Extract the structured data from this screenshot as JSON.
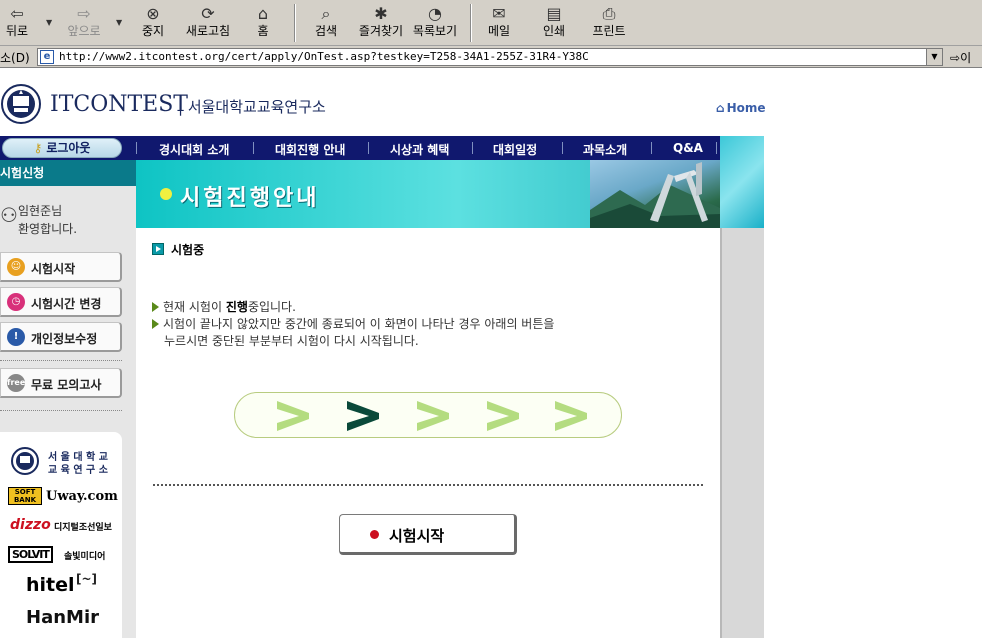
{
  "browser": {
    "toolbar": {
      "back": "뒤로",
      "forward": "앞으로",
      "stop": "중지",
      "refresh": "새로고침",
      "home": "홈",
      "search": "검색",
      "favorites": "즐겨찾기",
      "history": "목록보기",
      "mail": "메일",
      "print": "인쇄",
      "printer": "프린트"
    },
    "address": {
      "label": "소(D)",
      "url": "http://www2.itcontest.org/cert/apply/OnTest.asp?testkey=T258-34A1-255Z-31R4-Y38C",
      "go": "이"
    }
  },
  "header": {
    "logo_text": "ITCONTEST",
    "logo_sub": "| 서울대학교교육연구소",
    "home_link": "Home"
  },
  "nav": {
    "logout": "로그아웃",
    "items": [
      "경시대회 소개",
      "대회진행 안내",
      "시상과 혜택",
      "대회일정",
      "과목소개",
      "Q&A"
    ]
  },
  "sidebar": {
    "title": "시험신청",
    "user_name": "임현준님",
    "welcome": "환영합니다.",
    "menu": [
      {
        "label": "시험시작",
        "icon": "smile-icon",
        "color": "#e8a020"
      },
      {
        "label": "시험시간 변경",
        "icon": "clock-icon",
        "color": "#d8307a"
      },
      {
        "label": "개인정보수정",
        "icon": "info-icon",
        "color": "#2a5aa8"
      },
      {
        "label": "무료 모의고사",
        "icon": "free-icon",
        "color": "#888888"
      }
    ],
    "free_badge": "free",
    "partners": {
      "snu_line1": "서 울 대 학 교",
      "snu_line2": "교 육 연 구 소",
      "softbank": "SOFT BANK",
      "uway": "Uway.com",
      "dizzo": "dizzo",
      "dizzo_sub": "디지털조선일보",
      "solvit": "SOLVIT",
      "solvit_sub": "솔빛미디어",
      "hitel": "hitel",
      "hanmir": "HanMir"
    }
  },
  "main": {
    "banner_title": "시험진행안내",
    "section_title": "시험중",
    "msg1_prefix": "현재 시험이 ",
    "msg1_bold": "진행",
    "msg1_suffix": "중입니다.",
    "msg2": "시험이 끝나지 않았지만 중간에 종료되어 이 화면이 나타난 경우 아래의 버튼을",
    "msg3": "누르시면 중단된 부분부터 시험이 다시 시작됩니다.",
    "progress": {
      "steps": 5,
      "active_step": 2
    },
    "start_button": "시험시작"
  },
  "colors": {
    "nav_bg": "#10186e",
    "sidebar_title_bg": "#0a7a8a",
    "banner_teal": "#0ec4c4",
    "chevron_light": "#b4dc80",
    "chevron_active": "#0a4a3a",
    "start_dot": "#cc1020"
  }
}
